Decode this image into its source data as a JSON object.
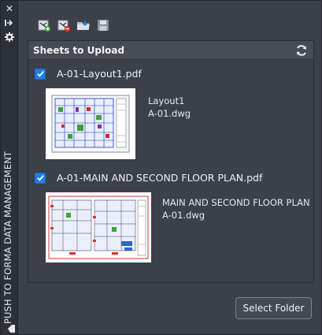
{
  "window": {
    "title": "PUSH TO FORMA DATA MANAGEMENT",
    "titlebar_icons": [
      "close-icon",
      "pin-icon",
      "settings-icon",
      "app-logo"
    ]
  },
  "toolbar": {
    "tools": [
      "add-sheet-icon",
      "remove-sheet-icon",
      "open-folder-icon",
      "save-icon"
    ]
  },
  "panel": {
    "header": "Sheets to Upload",
    "refresh_icon": "refresh-icon",
    "sheets": [
      {
        "checked": true,
        "file": "A-01-Layout1.pdf",
        "layout": "Layout1",
        "drawing": "A-01.dwg"
      },
      {
        "checked": true,
        "file": "A-01-MAIN AND SECOND FLOOR PLAN.pdf",
        "layout": "MAIN AND SECOND FLOOR PLAN",
        "drawing": "A-01.dwg"
      }
    ]
  },
  "footer": {
    "select_folder_label": "Select Folder"
  },
  "colors": {
    "background": "#3b4049",
    "titlebar": "#2c3038",
    "checkbox_accent": "#1e7ee4",
    "panel_header": "#464b55"
  }
}
